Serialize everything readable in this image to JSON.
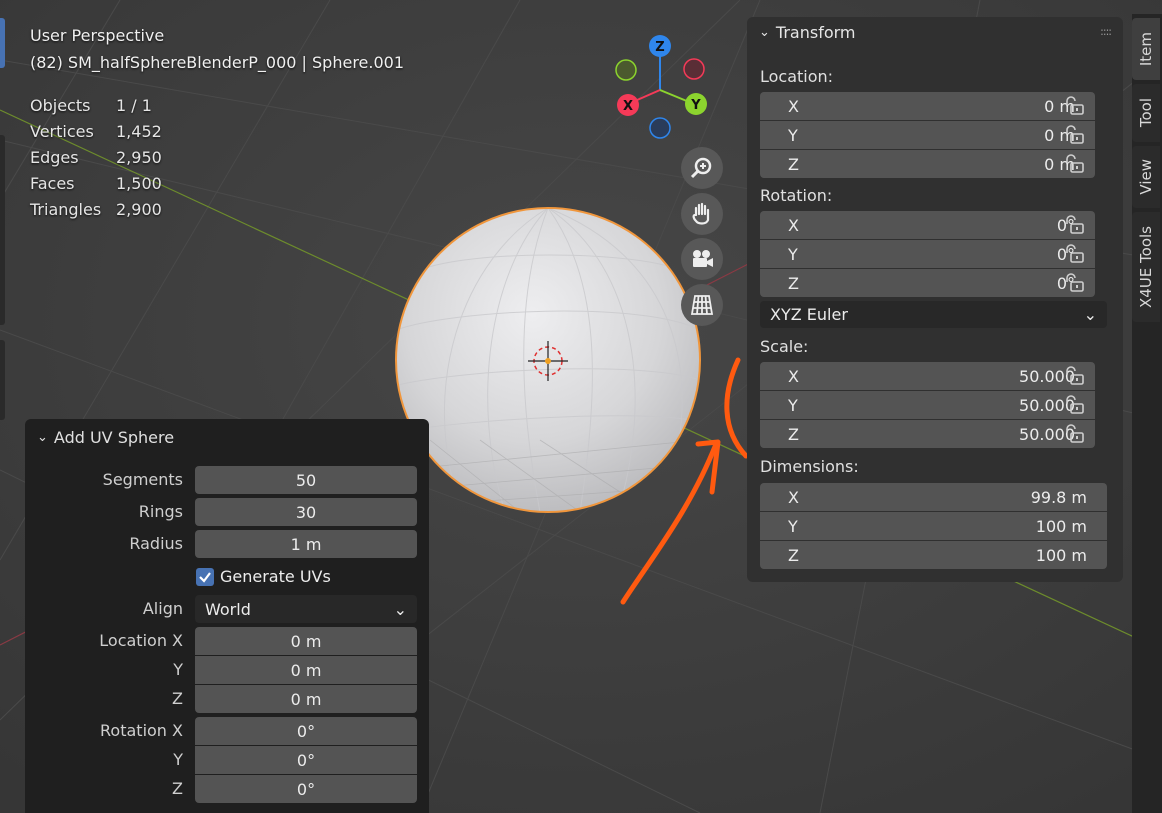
{
  "viewport": {
    "view_name": "User Perspective",
    "object_info": "(82) SM_halfSphereBlenderP_000 | Sphere.001",
    "stats": [
      {
        "label": "Objects",
        "value": "1 / 1"
      },
      {
        "label": "Vertices",
        "value": "1,452"
      },
      {
        "label": "Edges",
        "value": "2,950"
      },
      {
        "label": "Faces",
        "value": "1,500"
      },
      {
        "label": "Triangles",
        "value": "2,900"
      }
    ],
    "gizmo": {
      "z": "Z",
      "x": "X",
      "y": "Y"
    },
    "nav_buttons": [
      "zoom-icon",
      "pan-hand-icon",
      "camera-icon",
      "grid-projection-icon"
    ],
    "annotation_color": "#ff5a10"
  },
  "transform_panel": {
    "title": "Transform",
    "location": {
      "label": "Location:",
      "rows": [
        {
          "axis": "X",
          "value": "0 m"
        },
        {
          "axis": "Y",
          "value": "0 m"
        },
        {
          "axis": "Z",
          "value": "0 m"
        }
      ]
    },
    "rotation": {
      "label": "Rotation:",
      "rows": [
        {
          "axis": "X",
          "value": "0°"
        },
        {
          "axis": "Y",
          "value": "0°"
        },
        {
          "axis": "Z",
          "value": "0°"
        }
      ],
      "mode": "XYZ Euler"
    },
    "scale": {
      "label": "Scale:",
      "rows": [
        {
          "axis": "X",
          "value": "50.000"
        },
        {
          "axis": "Y",
          "value": "50.000"
        },
        {
          "axis": "Z",
          "value": "50.000"
        }
      ]
    },
    "dimensions": {
      "label": "Dimensions:",
      "rows": [
        {
          "axis": "X",
          "value": "99.8 m"
        },
        {
          "axis": "Y",
          "value": "100 m"
        },
        {
          "axis": "Z",
          "value": "100 m"
        }
      ]
    }
  },
  "sidebar_tabs": [
    "Item",
    "Tool",
    "View",
    "X4UE Tools"
  ],
  "operator_panel": {
    "title": "Add UV Sphere",
    "segments": {
      "label": "Segments",
      "value": "50"
    },
    "rings": {
      "label": "Rings",
      "value": "30"
    },
    "radius": {
      "label": "Radius",
      "value": "1 m"
    },
    "generate_uvs": {
      "label": "Generate UVs",
      "checked": true
    },
    "align": {
      "label": "Align",
      "value": "World"
    },
    "location": [
      {
        "label": "Location X",
        "value": "0 m"
      },
      {
        "label": "Y",
        "value": "0 m"
      },
      {
        "label": "Z",
        "value": "0 m"
      }
    ],
    "rotation": [
      {
        "label": "Rotation X",
        "value": "0°"
      },
      {
        "label": "Y",
        "value": "0°"
      },
      {
        "label": "Z",
        "value": "0°"
      }
    ]
  },
  "colors": {
    "accent_blue": "#4772b3",
    "selection_orange": "#f0963c",
    "axis_x": "#f53a58",
    "axis_y": "#8cd42e",
    "axis_z": "#2f86ec"
  }
}
